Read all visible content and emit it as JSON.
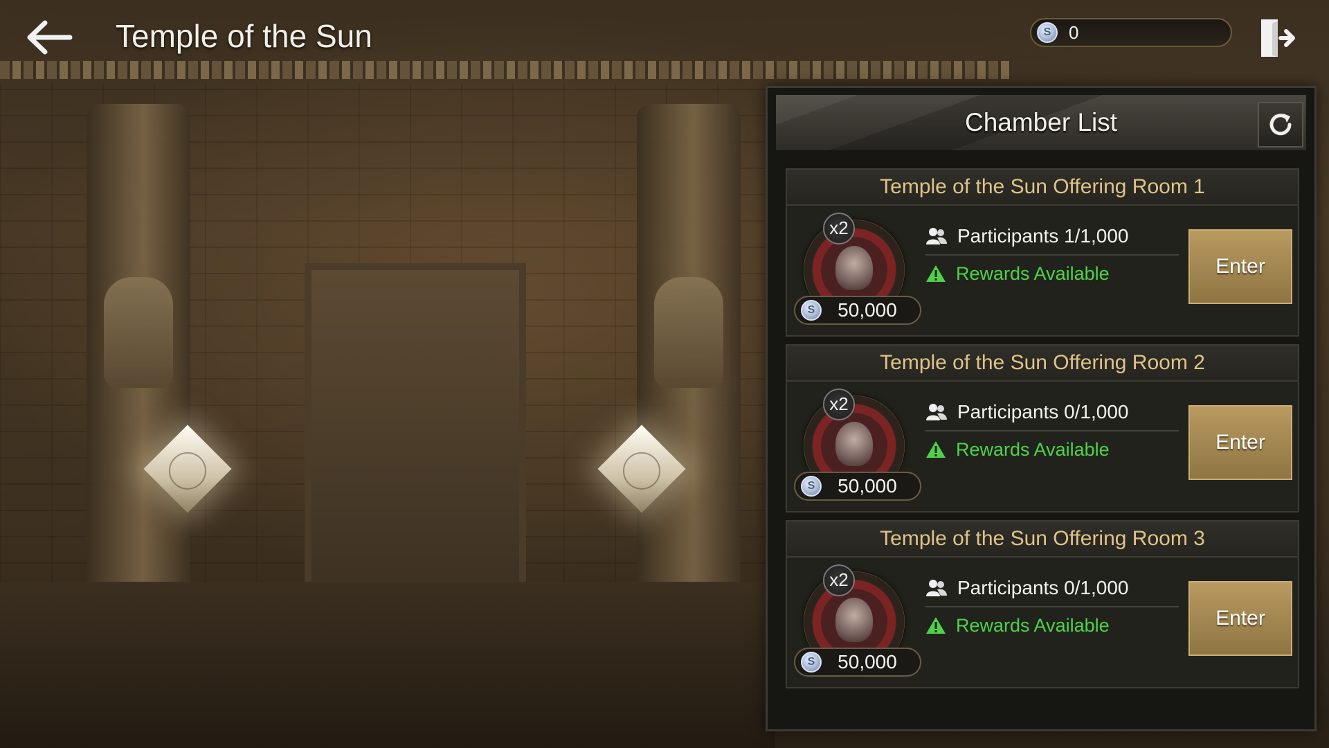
{
  "header": {
    "title": "Temple of the Sun",
    "currency_value": "0"
  },
  "panel": {
    "title": "Chamber List"
  },
  "rooms": [
    {
      "name": "Temple of the Sun Offering Room 1",
      "multiplier": "x2",
      "price": "50,000",
      "participants": "Participants 1/1,000",
      "rewards": "Rewards Available",
      "enter_label": "Enter"
    },
    {
      "name": "Temple of the Sun Offering Room 2",
      "multiplier": "x2",
      "price": "50,000",
      "participants": "Participants 0/1,000",
      "rewards": "Rewards Available",
      "enter_label": "Enter"
    },
    {
      "name": "Temple of the Sun Offering Room 3",
      "multiplier": "x2",
      "price": "50,000",
      "participants": "Participants 0/1,000",
      "rewards": "Rewards Available",
      "enter_label": "Enter"
    }
  ],
  "icons": {
    "back": "back-arrow-icon",
    "exit": "exit-door-icon",
    "refresh": "refresh-icon",
    "coin": "silver-coin-icon",
    "participants": "people-icon",
    "rewards": "warning-triangle-icon"
  },
  "colors": {
    "rewards_green": "#4ed24a",
    "room_title_gold": "#e0c389",
    "enter_button": "#a98b53"
  }
}
